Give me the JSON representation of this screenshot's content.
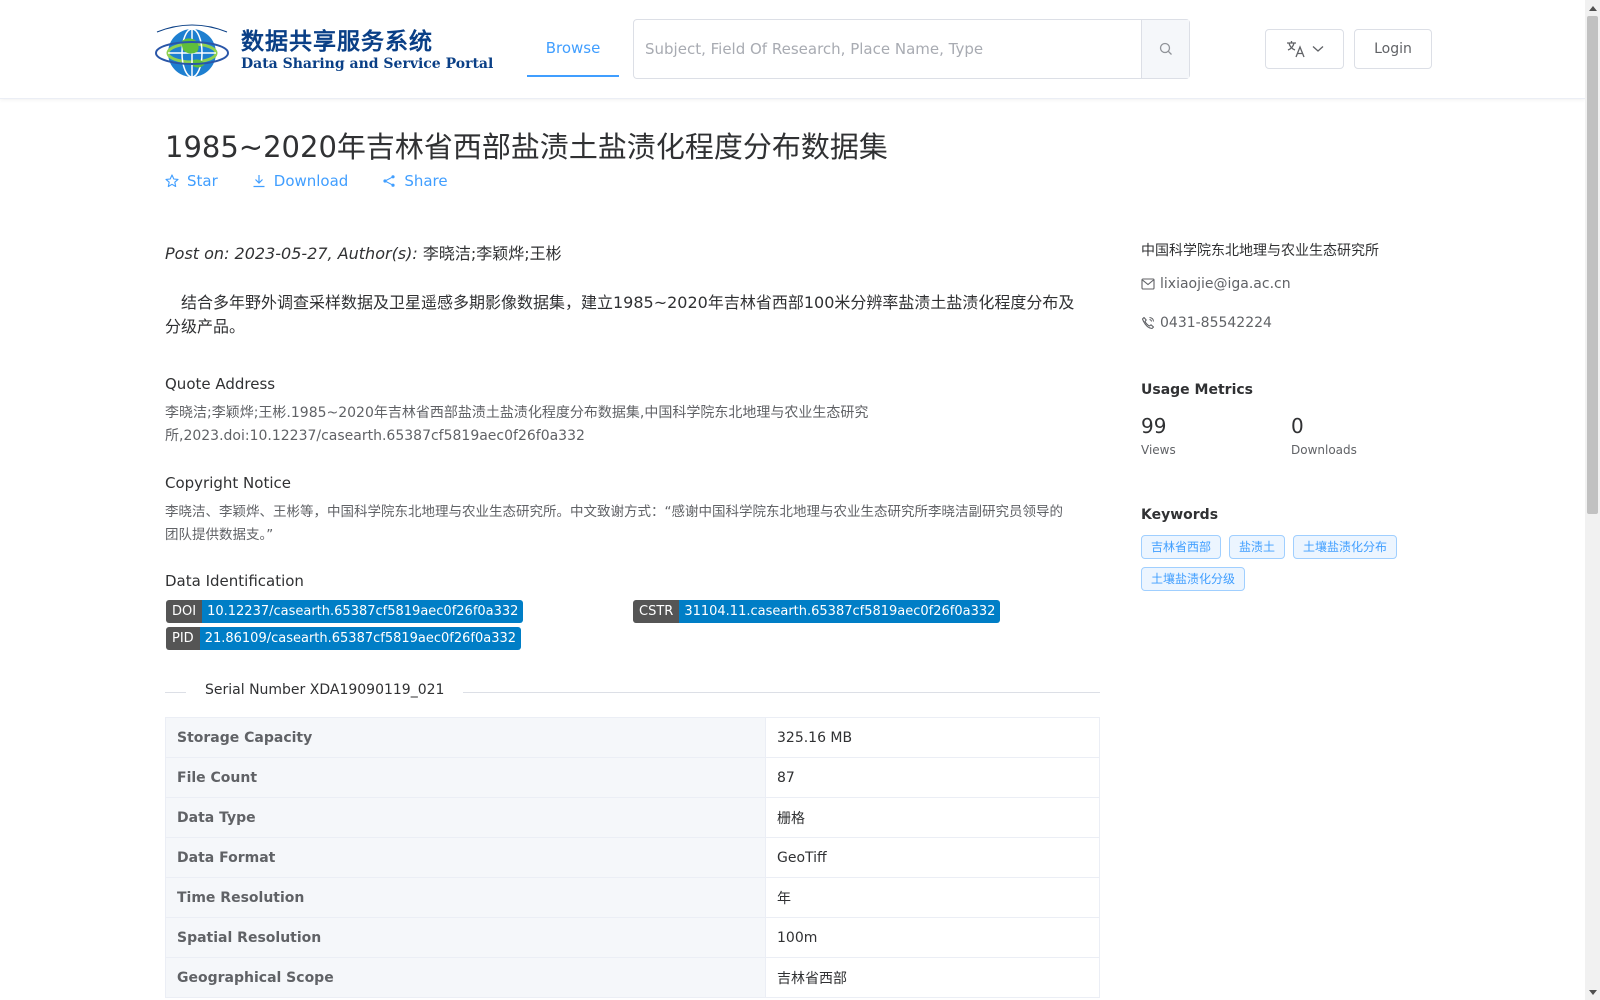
{
  "header": {
    "logo_cn": "数据共享服务系统",
    "logo_en": "Data Sharing and Service Portal",
    "nav_browse": "Browse",
    "search_placeholder": "Subject, Field Of Research, Place Name, Type",
    "login": "Login"
  },
  "dataset": {
    "title": "1985~2020年吉林省西部盐渍土盐渍化程度分布数据集",
    "actions": {
      "star": "Star",
      "download": "Download",
      "share": "Share"
    },
    "post_prefix": "Post on: 2023-05-27, Author(s): ",
    "authors": "李晓洁;李颖烨;王彬",
    "abstract": "结合多年野外调查采样数据及卫星遥感多期影像数据集，建立1985~2020年吉林省西部100米分辨率盐渍土盐渍化程度分布及分级产品。",
    "quote": {
      "title": "Quote Address",
      "line1": "李晓洁;李颖烨;王彬.1985~2020年吉林省西部盐渍土盐渍化程度分布数据集,中国科学院东北地理与农业生态研究",
      "line2": "所,2023.doi:10.12237/casearth.65387cf5819aec0f26f0a332"
    },
    "copyright": {
      "title": "Copyright Notice",
      "line1": "李晓洁、李颖烨、王彬等，中国科学院东北地理与农业生态研究所。中文致谢方式：“感谢中国科学院东北地理与农业生态研究所李晓洁副研究员领导的",
      "line2": "团队提供数据支。”"
    },
    "identification": {
      "title": "Data Identification",
      "doi_key": "DOI",
      "doi_val": "10.12237/casearth.65387cf5819aec0f26f0a332",
      "cstr_key": "CSTR",
      "cstr_val": "31104.11.casearth.65387cf5819aec0f26f0a332",
      "pid_key": "PID",
      "pid_val": "21.86109/casearth.65387cf5819aec0f26f0a332"
    },
    "serial": "Serial Number XDA19090119_021",
    "table": [
      {
        "key": "Storage Capacity",
        "value": "325.16 MB"
      },
      {
        "key": "File Count",
        "value": "87"
      },
      {
        "key": "Data Type",
        "value": "栅格"
      },
      {
        "key": "Data Format",
        "value": "GeoTiff"
      },
      {
        "key": "Time Resolution",
        "value": "年"
      },
      {
        "key": "Spatial Resolution",
        "value": "100m"
      },
      {
        "key": "Geographical Scope",
        "value": "吉林省西部"
      }
    ]
  },
  "sidebar": {
    "org": "中国科学院东北地理与农业生态研究所",
    "email": "lixiaojie@iga.ac.cn",
    "phone": "0431-85542224",
    "metrics_title": "Usage Metrics",
    "views": "99",
    "views_label": "Views",
    "downloads": "0",
    "downloads_label": "Downloads",
    "keywords_title": "Keywords",
    "keywords": [
      "吉林省西部",
      "盐渍土",
      "土壤盐渍化分布",
      "土壤盐渍化分级"
    ]
  },
  "colors": {
    "accent": "#409eff",
    "badge_key": "#555555",
    "badge_val": "#007ec6",
    "logo": "#0a3f86"
  }
}
